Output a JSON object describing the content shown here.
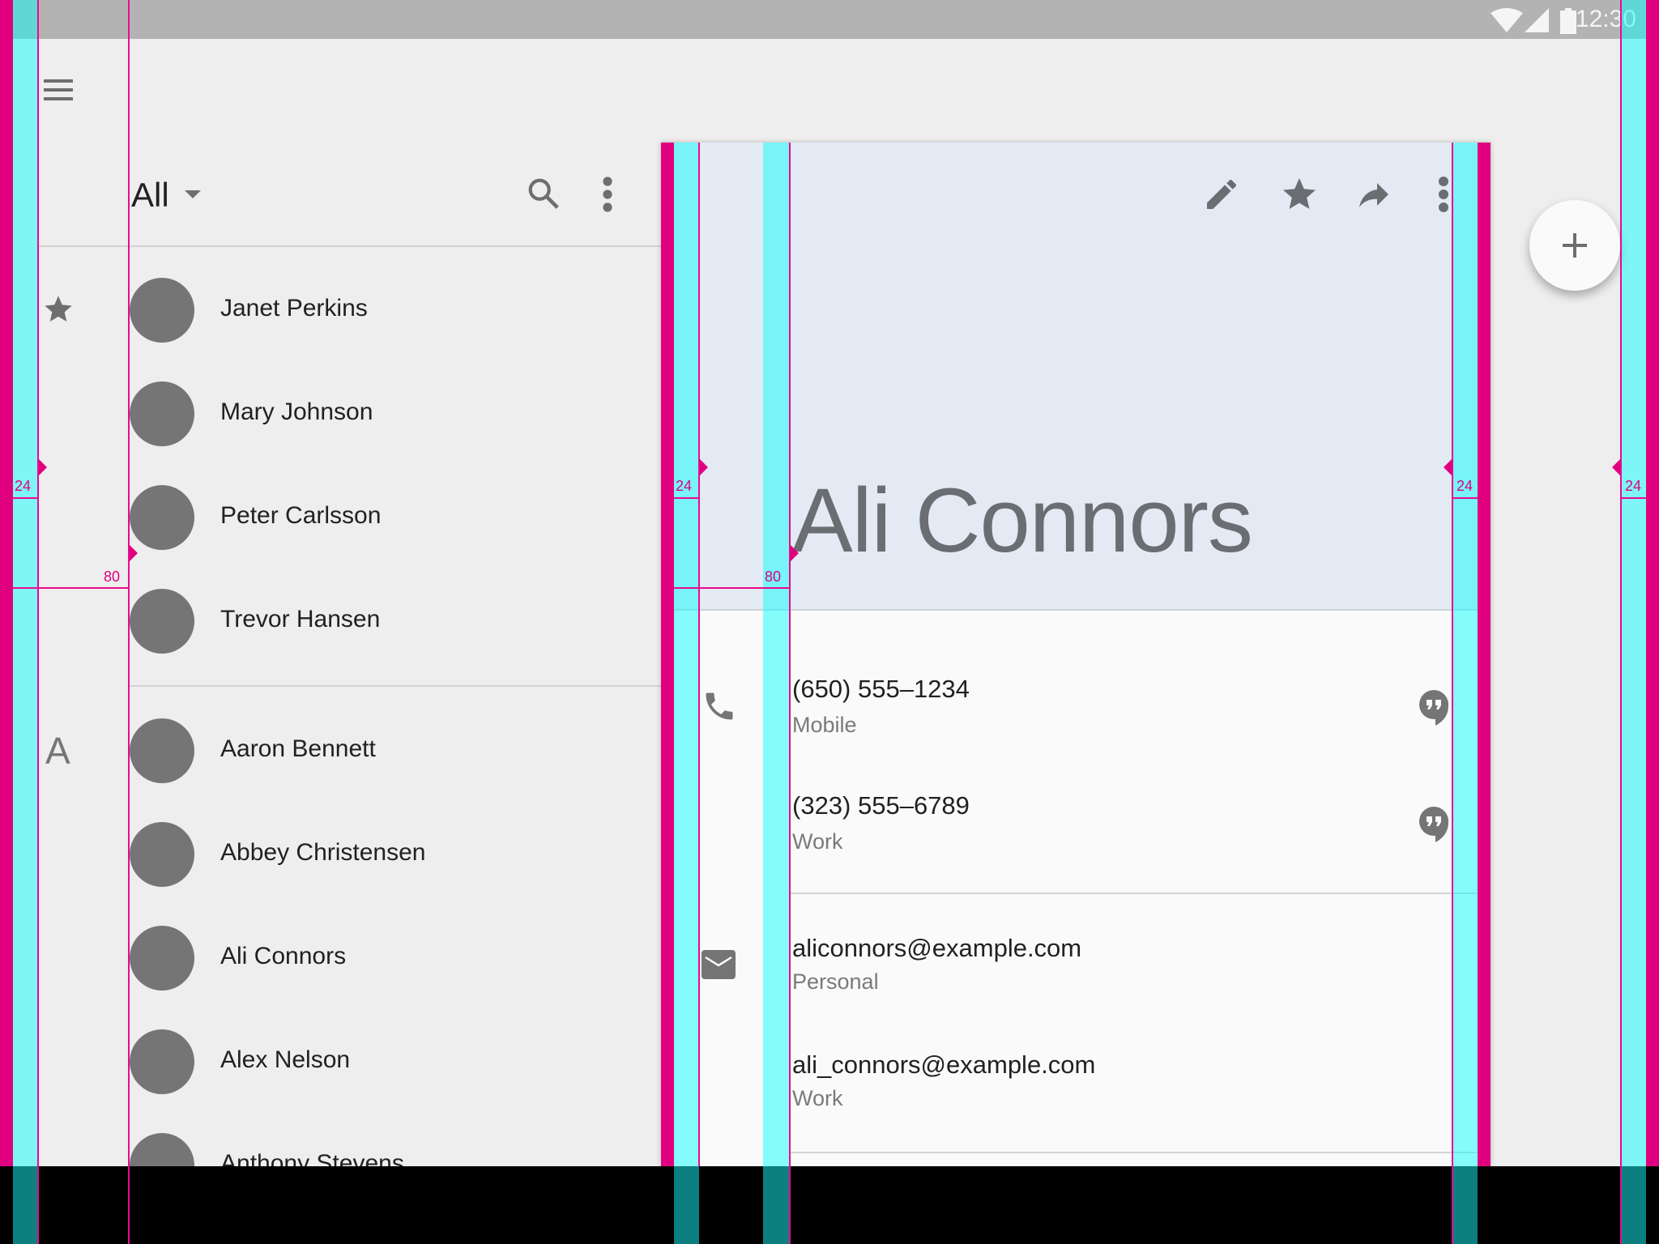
{
  "status_bar": {
    "time": "12:30",
    "icons": [
      "wifi-icon",
      "cellular-signal-icon",
      "battery-icon"
    ]
  },
  "app_bar": {
    "menu_icon": "hamburger-menu-icon"
  },
  "contact_list": {
    "filter": {
      "selected": "All",
      "icon": "dropdown-caret-icon"
    },
    "actions": [
      {
        "name": "search",
        "icon": "search-icon"
      },
      {
        "name": "more",
        "icon": "more-vert-icon"
      }
    ],
    "sections": [
      {
        "header_icon": "star-icon",
        "header_label": "",
        "contacts": [
          "Janet Perkins",
          "Mary Johnson",
          "Peter Carlsson",
          "Trevor Hansen"
        ]
      },
      {
        "header_icon": "",
        "header_label": "A",
        "contacts": [
          "Aaron Bennett",
          "Abbey Christensen",
          "Ali Connors",
          "Alex Nelson",
          "Anthony Stevens"
        ]
      }
    ]
  },
  "detail_card": {
    "title": "Ali Connors",
    "actions": [
      {
        "name": "edit",
        "icon": "pencil-icon"
      },
      {
        "name": "favorite",
        "icon": "star-icon"
      },
      {
        "name": "share",
        "icon": "share-forward-icon"
      },
      {
        "name": "more",
        "icon": "more-vert-icon"
      }
    ],
    "phones": {
      "icon": "phone-icon",
      "items": [
        {
          "value": "(650) 555–1234",
          "type": "Mobile",
          "action_icon": "hangouts-message-icon"
        },
        {
          "value": "(323) 555–6789",
          "type": "Work",
          "action_icon": "hangouts-message-icon"
        }
      ]
    },
    "emails": {
      "icon": "email-icon",
      "items": [
        {
          "value": "aliconnors@example.com",
          "type": "Personal"
        },
        {
          "value": "ali_connors@example.com",
          "type": "Work"
        }
      ]
    }
  },
  "fab": {
    "icon": "add-icon",
    "label": "+"
  },
  "keyline_overlay": {
    "labels": [
      "24",
      "80",
      "24",
      "80",
      "24",
      "24"
    ],
    "colors": {
      "margin": "#e0007f",
      "keyline_fill": "#80f8f8",
      "keyline": "#ea0a8e"
    }
  }
}
